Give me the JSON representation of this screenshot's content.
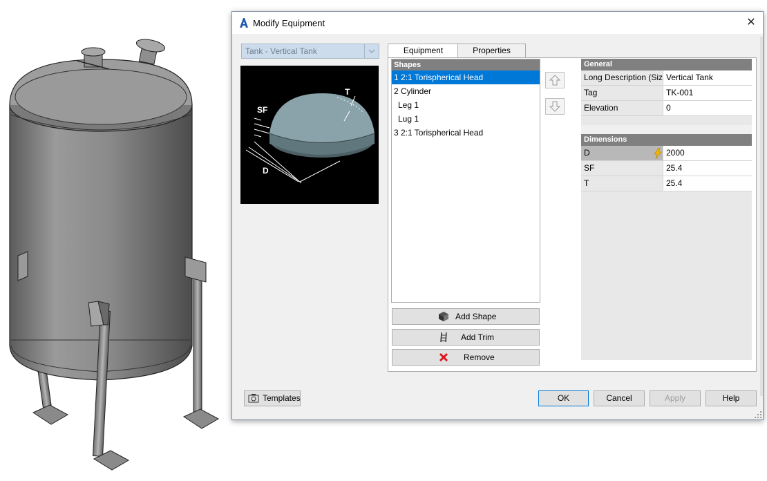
{
  "window": {
    "title": "Modify Equipment"
  },
  "left": {
    "combo_value": "Tank - Vertical Tank"
  },
  "preview": {
    "label_t": "T",
    "label_sf": "SF",
    "label_d": "D"
  },
  "tabs": [
    {
      "label": "Equipment"
    },
    {
      "label": "Properties"
    }
  ],
  "shapes": {
    "header": "Shapes",
    "items": [
      {
        "label": "1 2:1 Torispherical Head"
      },
      {
        "label": "2 Cylinder"
      },
      {
        "label": "Leg 1"
      },
      {
        "label": "Lug 1"
      },
      {
        "label": "3 2:1 Torispherical Head"
      }
    ]
  },
  "actions": {
    "add_shape": "Add Shape",
    "add_trim": "Add Trim",
    "remove": "Remove"
  },
  "general": {
    "header": "General",
    "rows": [
      {
        "name": "Long Description (Size)",
        "value": "Vertical Tank"
      },
      {
        "name": "Tag",
        "value": "TK-001"
      },
      {
        "name": "Elevation",
        "value": "0"
      }
    ]
  },
  "dimensions": {
    "header": "Dimensions",
    "rows": [
      {
        "name": "D",
        "value": "2000"
      },
      {
        "name": "SF",
        "value": "25.4"
      },
      {
        "name": "T",
        "value": "25.4"
      }
    ]
  },
  "footer": {
    "templates": "Templates",
    "ok": "OK",
    "cancel": "Cancel",
    "apply": "Apply",
    "help": "Help"
  },
  "colors": {
    "selection": "#0078d7",
    "header_gray": "#808080",
    "remove_x": "#d9181e",
    "lightning": "#f5b800"
  }
}
